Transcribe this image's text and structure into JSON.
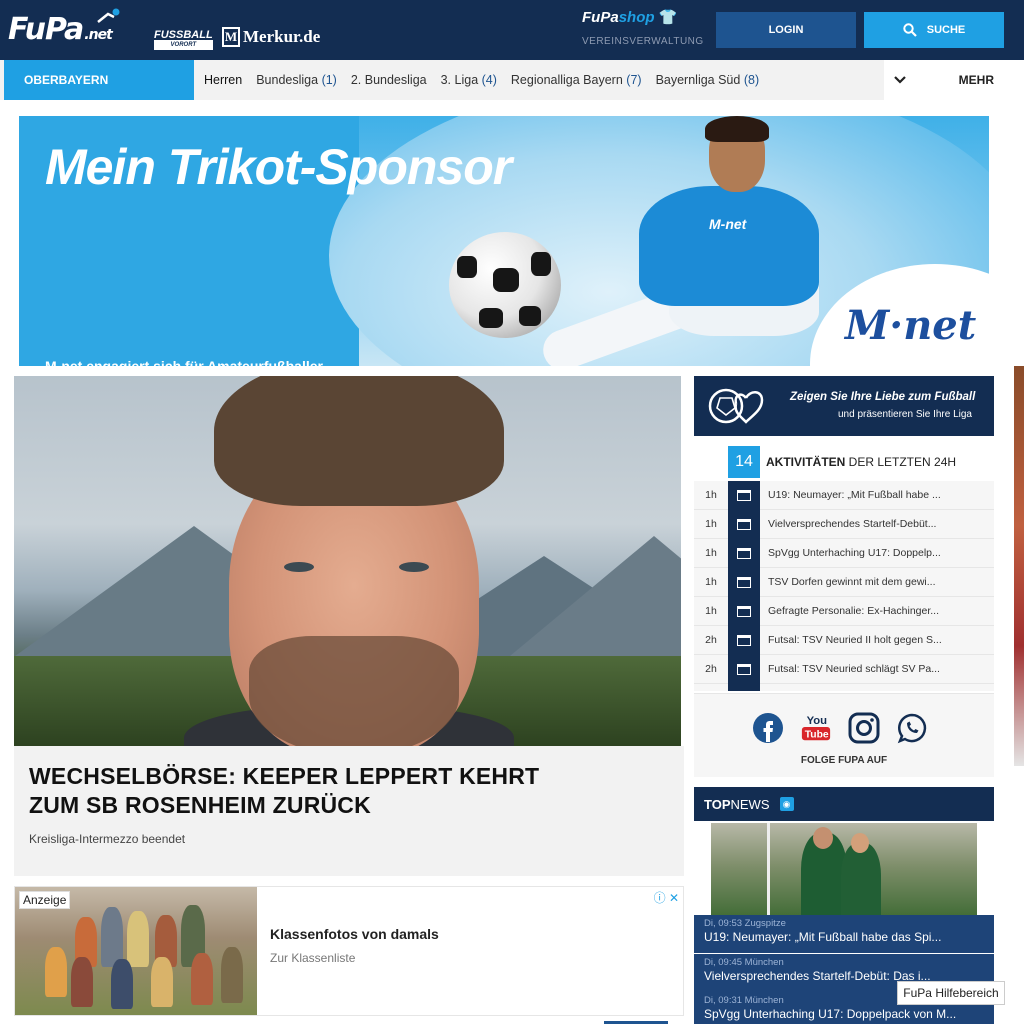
{
  "header": {
    "logo_main": "FuPa",
    "logo_suffix": ".net",
    "partner1_top": "FUSSBALL",
    "partner1_bottom": "VORORT",
    "partner2": "Merkur.de",
    "shop_left": "FuPa",
    "shop_right": "shop",
    "vereinsverwaltung": "VEREINSVERWALTUNG",
    "login_label": "LOGIN",
    "search_label": "SUCHE"
  },
  "nav": {
    "region": "OBERBAYERN",
    "first": "Herren",
    "items": [
      {
        "label": "Bundesliga",
        "count": "(1)"
      },
      {
        "label": "2. Bundesliga",
        "count": ""
      },
      {
        "label": "3. Liga",
        "count": "(4)"
      },
      {
        "label": "Regionalliga Bayern",
        "count": "(7)"
      },
      {
        "label": "Bayernliga Süd",
        "count": "(8)"
      }
    ],
    "more": "MEHR"
  },
  "banner": {
    "title": "Mein Trikot-Sponsor",
    "subtitle": "M-net engagiert sich für Amateurfußballer",
    "brand": "M·net",
    "shirt_text": "M-net"
  },
  "article": {
    "title": "WECHSELBÖRSE: KEEPER LEPPERT KEHRT ZUM SB ROSENHEIM ZURÜCK",
    "subtitle": "Kreisliga-Intermezzo beendet"
  },
  "ad": {
    "tag": "Anzeige",
    "title": "Klassenfotos von damals",
    "link": "Zur Klassenliste",
    "info": "ⓘ ✕"
  },
  "promo": {
    "title": "Zeigen Sie Ihre Liebe zum Fußball",
    "subtitle": "und präsentieren Sie Ihre Liga"
  },
  "activities": {
    "count": "14",
    "label_bold": "AKTIVITÄTEN",
    "label_rest": " DER LETZTEN 24H",
    "items": [
      {
        "time": "1h",
        "text": "U19: Neumayer: „Mit Fußball habe ..."
      },
      {
        "time": "1h",
        "text": "Vielversprechendes Startelf-Debüt..."
      },
      {
        "time": "1h",
        "text": "SpVgg Unterhaching U17: Doppelp..."
      },
      {
        "time": "1h",
        "text": "TSV Dorfen gewinnt mit dem gewi..."
      },
      {
        "time": "1h",
        "text": "Gefragte Personalie: Ex-Hachinger..."
      },
      {
        "time": "2h",
        "text": "Futsal: TSV Neuried II holt gegen S..."
      },
      {
        "time": "2h",
        "text": "Futsal: TSV Neuried schlägt SV Pa..."
      }
    ]
  },
  "social": {
    "youtube_top": "You",
    "youtube_bottom": "Tube",
    "label": "FOLGE FUPA AUF"
  },
  "topnews": {
    "label_bold": "TOP",
    "label_rest": "NEWS",
    "items": [
      {
        "meta": "Di, 09:53 Zugspitze",
        "title": "U19: Neumayer: „Mit Fußball habe das Spi..."
      },
      {
        "meta": "Di, 09:45 München",
        "title": "Vielversprechendes Startelf-Debüt: Das i..."
      },
      {
        "meta": "Di, 09:31 München",
        "title": "SpVgg Unterhaching U17: Doppelpack von M..."
      }
    ]
  },
  "help": "FuPa Hilfebereich",
  "colors": {
    "navy": "#132d52",
    "blue": "#1fa0e3",
    "button": "#1e5490"
  }
}
